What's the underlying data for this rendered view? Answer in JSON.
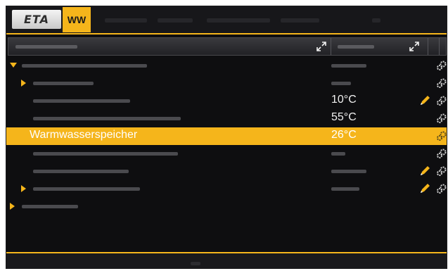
{
  "header_tab": {
    "logo": "ETA",
    "active_tab": "WW"
  },
  "colors": {
    "accent": "#f5b51b",
    "background": "#0e0e10",
    "selected_text": "#ffffff"
  },
  "tree": {
    "selected_row": {
      "label": "Warmwasserspeicher",
      "value": "26°C"
    },
    "values": {
      "row3": "10°C",
      "row4": "55°C"
    }
  },
  "icons": [
    "expand-icon",
    "gear-icon",
    "pencil-icon",
    "arrow-right-icon",
    "arrow-down-icon"
  ]
}
